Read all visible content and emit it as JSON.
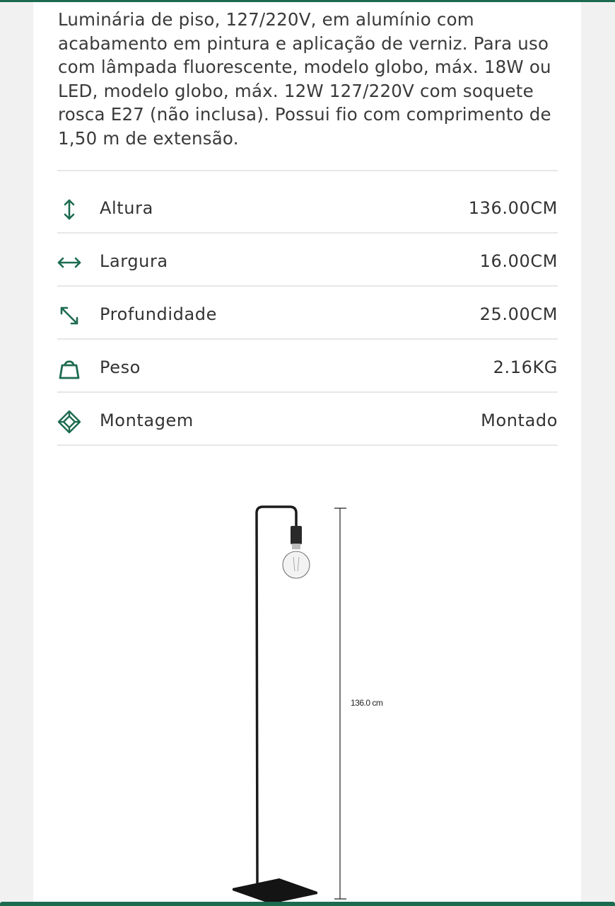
{
  "product": {
    "description": "Luminária de piso, 127/220V, em alumínio com acabamento em pintura e aplicação de verniz. Para uso com lâmpada fluorescente, modelo globo, máx. 18W ou LED, modelo globo, máx. 12W 127/220V com soquete rosca E27 (não inclusa). Possui fio com comprimento de 1,50 m de extensão."
  },
  "specs": [
    {
      "icon": "vertical-arrows-icon",
      "label": "Altura",
      "value": "136.00CM"
    },
    {
      "icon": "horizontal-arrows-icon",
      "label": "Largura",
      "value": "16.00CM"
    },
    {
      "icon": "diagonal-arrows-icon",
      "label": "Profundidade",
      "value": "25.00CM"
    },
    {
      "icon": "weight-bag-icon",
      "label": "Peso",
      "value": "2.16KG"
    },
    {
      "icon": "cube-icon",
      "label": "Montagem",
      "value": "Montado"
    }
  ],
  "diagram": {
    "dimension_label": "136.0 cm"
  },
  "colors": {
    "accent": "#1d6b4f",
    "text": "#333333",
    "divider": "#e7e7e7"
  }
}
